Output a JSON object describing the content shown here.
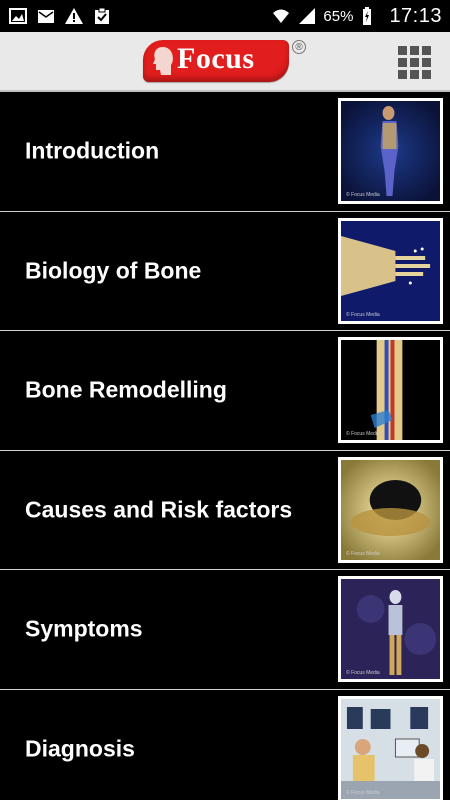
{
  "status_bar": {
    "notification_icons": [
      "image-icon",
      "mail-icon",
      "warning-icon",
      "clipboard-check-icon"
    ],
    "wifi_icon": "wifi-icon",
    "signal_icon": "signal-icon",
    "battery_percent": "65%",
    "battery_icon": "battery-charging-icon",
    "time": "17:13"
  },
  "header": {
    "logo_text": "Focus",
    "logo_registered": "®",
    "menu_icon": "grid-menu-icon",
    "brand_color": "#e11d1d"
  },
  "items": [
    {
      "label": "Introduction",
      "thumb_caption": "© Focus Media"
    },
    {
      "label": "Biology of Bone",
      "thumb_caption": "© Focus Media"
    },
    {
      "label": "Bone Remodelling",
      "thumb_caption": "© Focus Media"
    },
    {
      "label": "Causes and Risk factors",
      "thumb_caption": "© Focus Media"
    },
    {
      "label": "Symptoms",
      "thumb_caption": "© Focus Media"
    },
    {
      "label": "Diagnosis",
      "thumb_caption": "© Focus Media"
    }
  ]
}
